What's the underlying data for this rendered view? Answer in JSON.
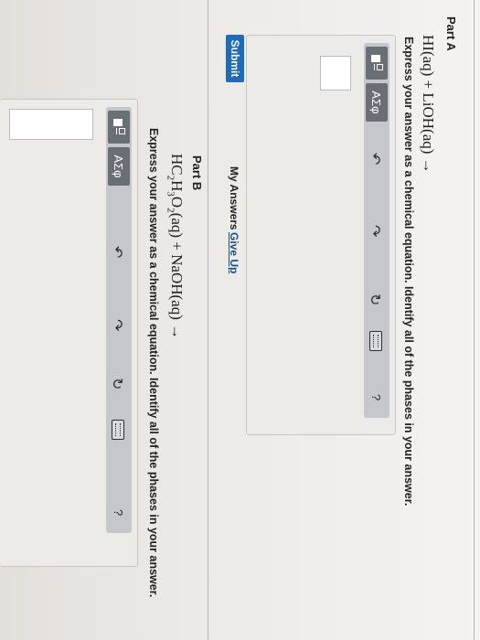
{
  "part_a": {
    "title": "Part A",
    "equation": "HI(aq) + LiOH(aq) →",
    "instruction": "Express your answer as a chemical equation. Identify all of the phases in your answer.",
    "toolbar": {
      "symbols_label": "ΑΣφ"
    },
    "answer_value": "",
    "submit_label": "Submit",
    "my_answers_label": "My Answers",
    "give_up_label": "Give Up"
  },
  "part_b": {
    "title": "Part B",
    "equation_parts": {
      "h": "HC",
      "s1": "2",
      "h2": "H",
      "s2": "3",
      "o": "O",
      "s3": "2",
      "rest": "(aq) + NaOH(aq) →"
    },
    "instruction": "Express your answer as a chemical equation. Identify all of the phases in your answer.",
    "toolbar": {
      "symbols_label": "ΑΣφ"
    },
    "answer_value": ""
  },
  "icons": [
    "template-icon",
    "undo-icon",
    "redo-icon",
    "reset-icon",
    "keyboard-icon",
    "help-icon"
  ]
}
